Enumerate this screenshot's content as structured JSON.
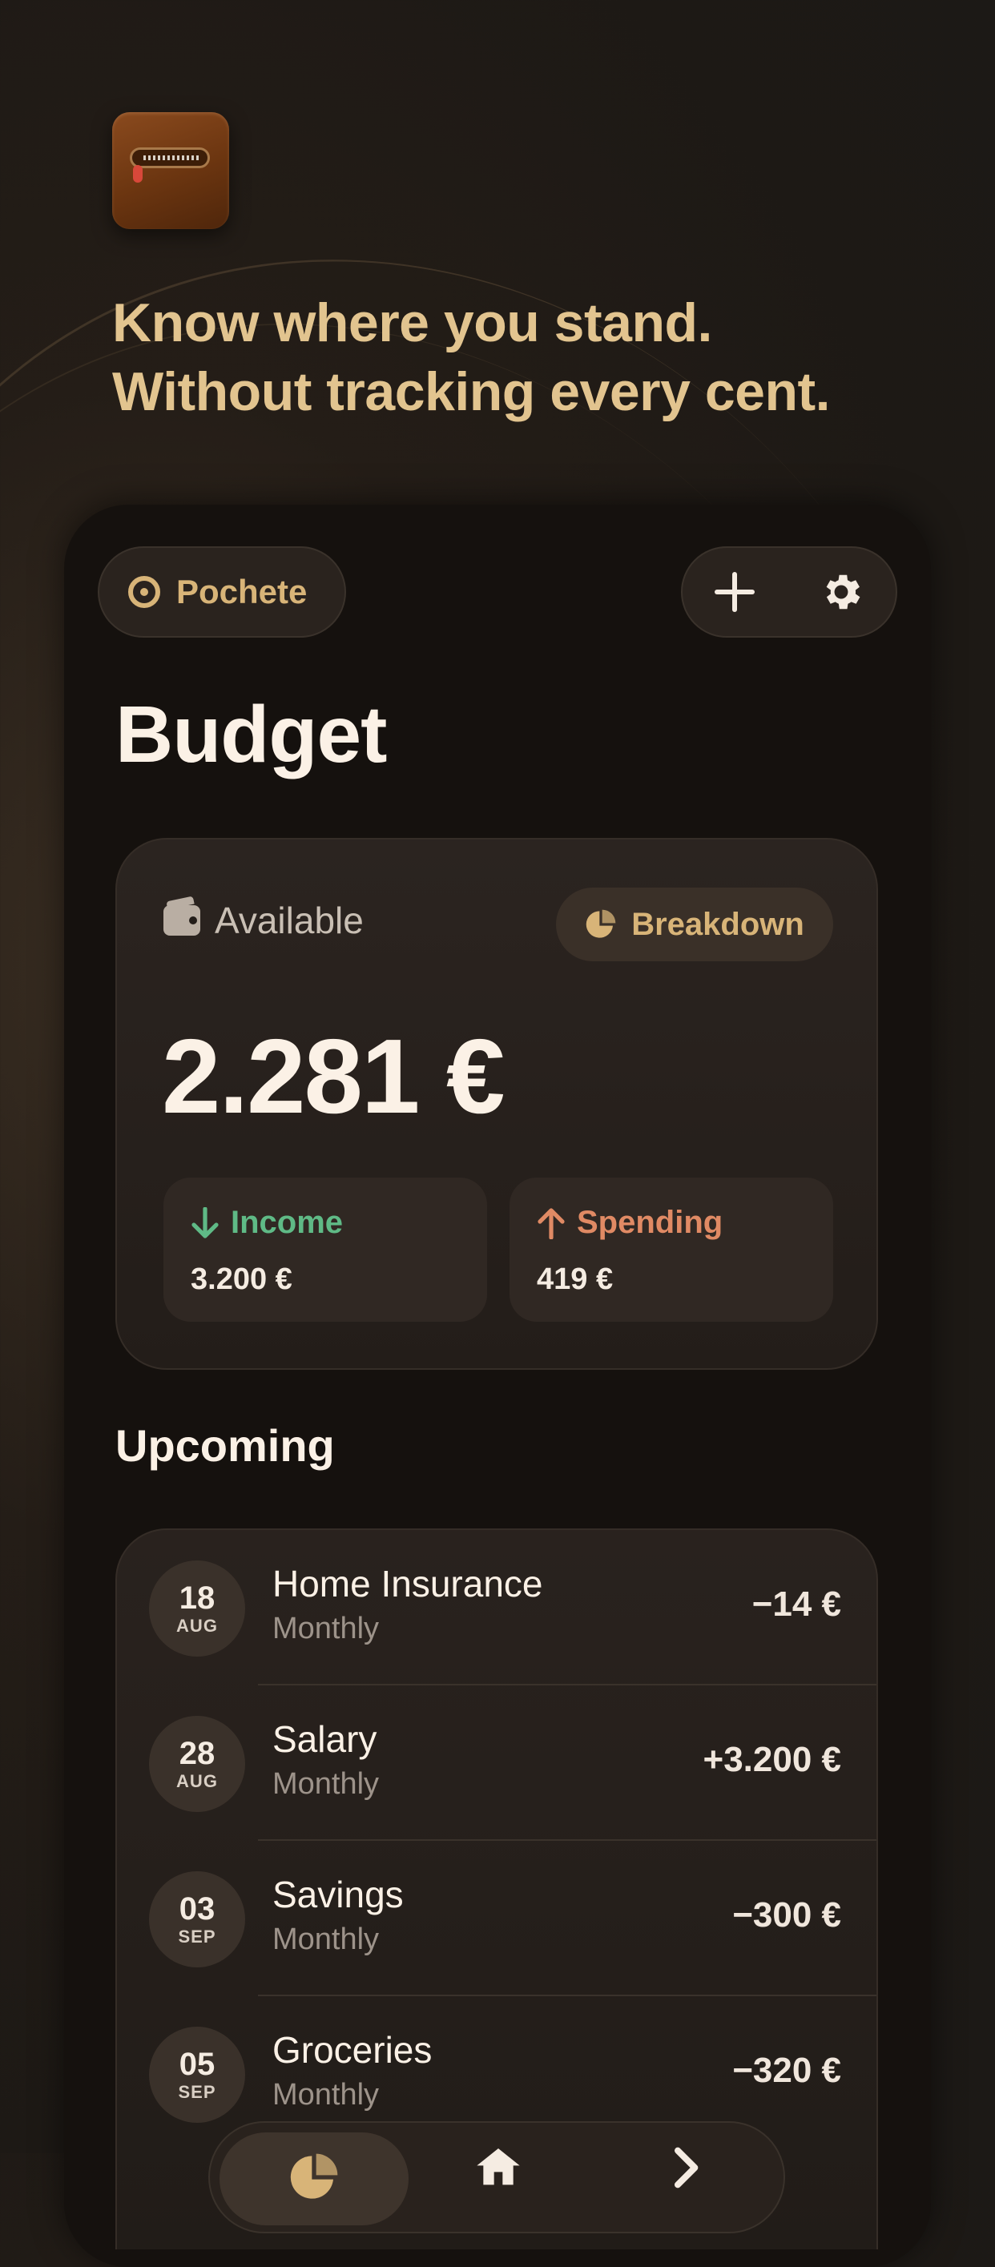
{
  "headline": {
    "line1": "Know where you stand.",
    "line2": "Without tracking every cent."
  },
  "header": {
    "brand": "Pochete"
  },
  "page_title": "Budget",
  "budget": {
    "available_label": "Available",
    "breakdown_label": "Breakdown",
    "amount": "2.281 €",
    "income_label": "Income",
    "income_value": "3.200 €",
    "spending_label": "Spending",
    "spending_value": "419 €"
  },
  "upcoming": {
    "title": "Upcoming",
    "items": [
      {
        "day": "18",
        "month": "AUG",
        "title": "Home Insurance",
        "frequency": "Monthly",
        "amount": "−14 €"
      },
      {
        "day": "28",
        "month": "AUG",
        "title": "Salary",
        "frequency": "Monthly",
        "amount": "+3.200 €"
      },
      {
        "day": "03",
        "month": "SEP",
        "title": "Savings",
        "frequency": "Monthly",
        "amount": "−300 €"
      },
      {
        "day": "05",
        "month": "SEP",
        "title": "Groceries",
        "frequency": "Monthly",
        "amount": "−320 €"
      }
    ]
  },
  "colors": {
    "accent_gold": "#d8b478",
    "income_green": "#5fba86",
    "spending_orange": "#e08a64"
  },
  "icons": {
    "app": "wallet-zipper-icon",
    "brand": "target-icon",
    "add": "plus-icon",
    "settings": "gear-icon",
    "available": "wallet-icon",
    "breakdown": "pie-chart-icon",
    "income": "arrow-down-icon",
    "spending": "arrow-up-icon"
  }
}
